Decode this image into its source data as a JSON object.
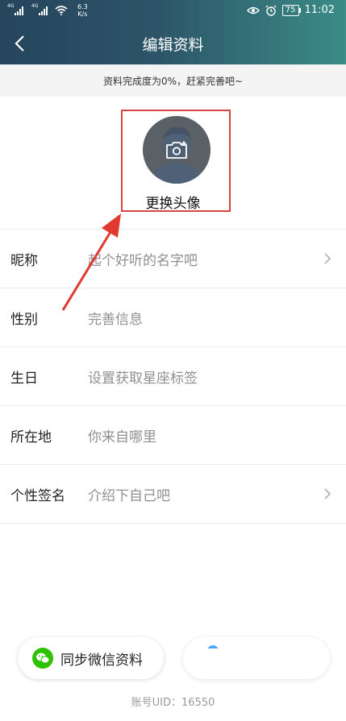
{
  "status_bar": {
    "signal1_tag": "4G",
    "signal2_tag": "4G",
    "net_speed_value": "6.3",
    "net_speed_unit": "K/s",
    "battery": "75",
    "time": "11:02"
  },
  "header": {
    "title": "编辑资料"
  },
  "tip": {
    "text": "资料完成度为0%，赶紧完善吧~"
  },
  "avatar": {
    "label": "更换头像"
  },
  "form": {
    "rows": [
      {
        "label": "昵称",
        "placeholder": "起个好听的名字吧",
        "has_arrow": true
      },
      {
        "label": "性别",
        "placeholder": "完善信息",
        "has_arrow": false
      },
      {
        "label": "生日",
        "placeholder": "设置获取星座标签",
        "has_arrow": false
      },
      {
        "label": "所在地",
        "placeholder": "你来自哪里",
        "has_arrow": false
      },
      {
        "label": "个性签名",
        "placeholder": "介绍下自己吧",
        "has_arrow": true
      }
    ]
  },
  "bottom": {
    "sync_wechat_label": "同步微信资料",
    "uid": "账号UID：16550"
  },
  "colors": {
    "header_start": "#25455c",
    "header_end": "#3a8c87",
    "highlight_red": "#d9453f",
    "wechat_green": "#2dc100"
  }
}
